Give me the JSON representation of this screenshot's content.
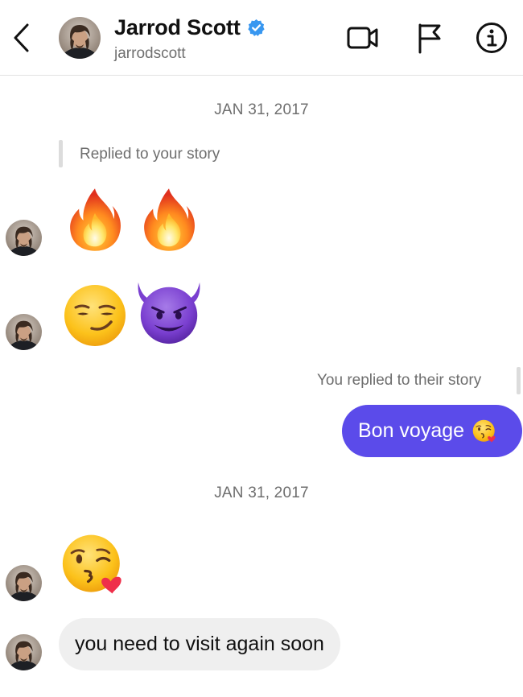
{
  "header": {
    "name": "Jarrod Scott",
    "username": "jarrodscott",
    "icons": {
      "back": "chevron-left-icon",
      "verified": "verified-badge-icon",
      "video": "video-call-icon",
      "flag": "flag-icon",
      "info": "info-icon"
    }
  },
  "thread": {
    "date_1": "JAN 31, 2017",
    "story_reply_in": "Replied to your story",
    "emoji_row_1": [
      "fire",
      "fire"
    ],
    "emoji_row_2": [
      "smirking-face",
      "smiling-face-with-horns"
    ],
    "story_reply_out": "You replied to their story",
    "outgoing_message": "Bon voyage",
    "outgoing_emoji": "face-blowing-a-kiss",
    "date_2": "JAN 31, 2017",
    "emoji_row_3": [
      "face-blowing-a-kiss"
    ],
    "incoming_message": "you need to visit again soon"
  },
  "colors": {
    "outgoing_bubble": "#5b4bea",
    "incoming_bubble": "#efefef",
    "verified_badge": "#3897f0",
    "meta_text": "#6e6e6e"
  }
}
